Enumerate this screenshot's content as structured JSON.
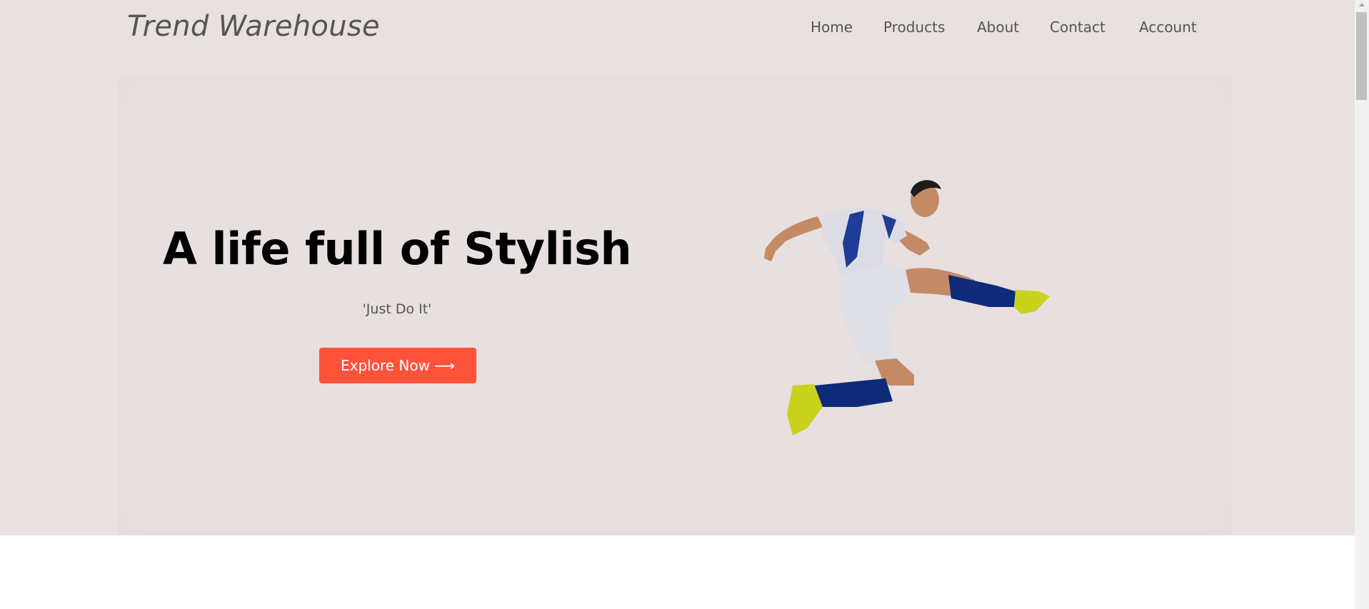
{
  "brand": {
    "logo_text": "Trend Warehouse"
  },
  "nav": {
    "items": [
      {
        "label": "Home"
      },
      {
        "label": "Products"
      },
      {
        "label": "About"
      },
      {
        "label": "Contact"
      },
      {
        "label": "Account"
      }
    ]
  },
  "hero": {
    "headline": "A life full of Stylish",
    "tagline": "'Just Do It'",
    "cta_label": "Explore Now ⟶",
    "image_icon": "soccer-player-kick-image"
  },
  "colors": {
    "hero_background": "#e9e0e0",
    "accent": "#ff523b",
    "text_dark": "#000000",
    "text_muted": "#555555"
  }
}
